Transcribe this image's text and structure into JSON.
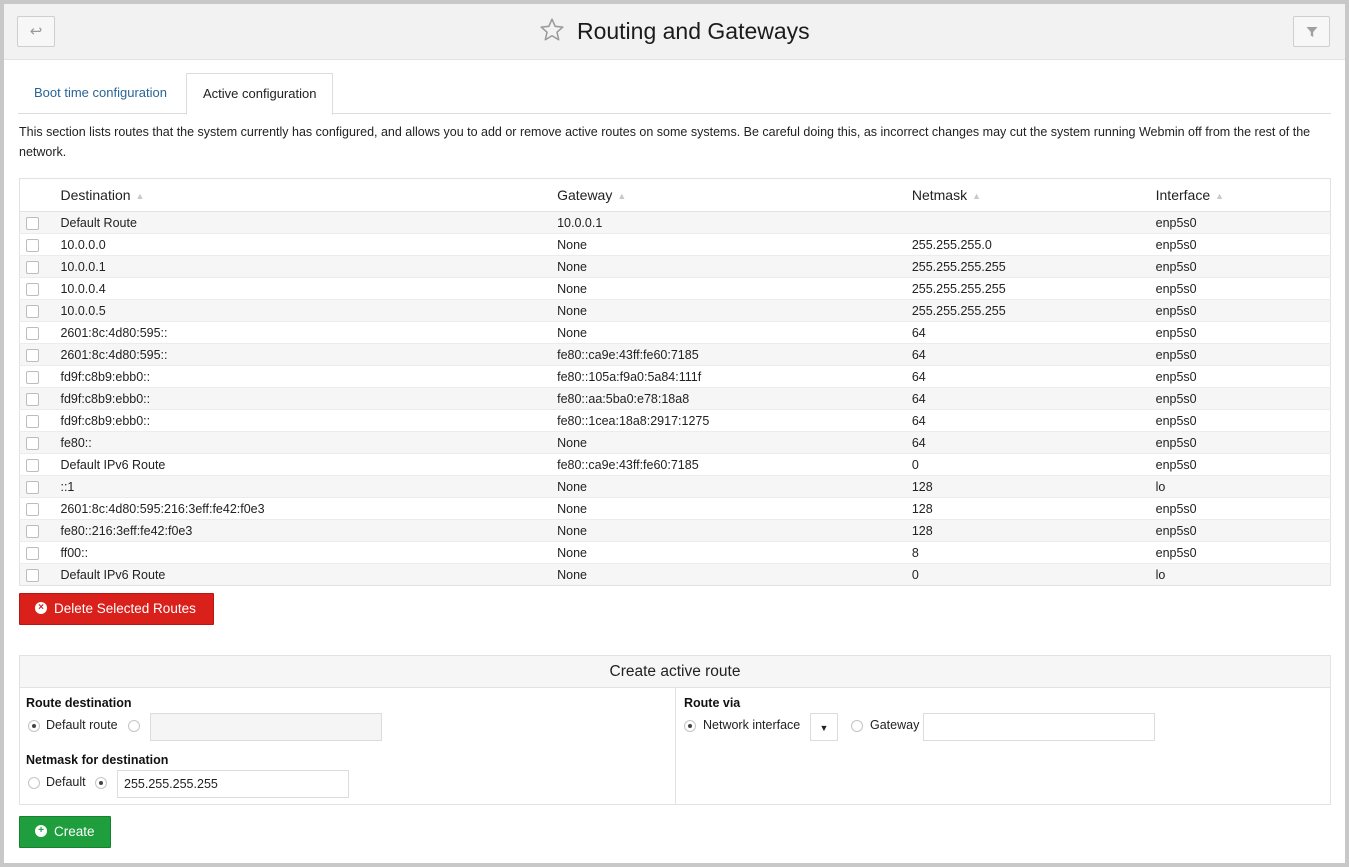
{
  "header": {
    "title": "Routing and Gateways",
    "back_icon": "↩",
    "filter_icon": "filter-icon"
  },
  "tabs": [
    {
      "label": "Boot time configuration",
      "active": false
    },
    {
      "label": "Active configuration",
      "active": true
    }
  ],
  "description": "This section lists routes that the system currently has configured, and allows you to add or remove active routes on some systems. Be careful doing this, as incorrect changes may cut the system running Webmin off from the rest of the network.",
  "table": {
    "columns": [
      "Destination",
      "Gateway",
      "Netmask",
      "Interface"
    ],
    "rows": [
      [
        "Default Route",
        "10.0.0.1",
        "",
        "enp5s0"
      ],
      [
        "10.0.0.0",
        "None",
        "255.255.255.0",
        "enp5s0"
      ],
      [
        "10.0.0.1",
        "None",
        "255.255.255.255",
        "enp5s0"
      ],
      [
        "10.0.0.4",
        "None",
        "255.255.255.255",
        "enp5s0"
      ],
      [
        "10.0.0.5",
        "None",
        "255.255.255.255",
        "enp5s0"
      ],
      [
        "2601:8c:4d80:595::",
        "None",
        "64",
        "enp5s0"
      ],
      [
        "2601:8c:4d80:595::",
        "fe80::ca9e:43ff:fe60:7185",
        "64",
        "enp5s0"
      ],
      [
        "fd9f:c8b9:ebb0::",
        "fe80::105a:f9a0:5a84:111f",
        "64",
        "enp5s0"
      ],
      [
        "fd9f:c8b9:ebb0::",
        "fe80::aa:5ba0:e78:18a8",
        "64",
        "enp5s0"
      ],
      [
        "fd9f:c8b9:ebb0::",
        "fe80::1cea:18a8:2917:1275",
        "64",
        "enp5s0"
      ],
      [
        "fe80::",
        "None",
        "64",
        "enp5s0"
      ],
      [
        "Default IPv6 Route",
        "fe80::ca9e:43ff:fe60:7185",
        "0",
        "enp5s0"
      ],
      [
        "::1",
        "None",
        "128",
        "lo"
      ],
      [
        "2601:8c:4d80:595:216:3eff:fe42:f0e3",
        "None",
        "128",
        "enp5s0"
      ],
      [
        "fe80::216:3eff:fe42:f0e3",
        "None",
        "128",
        "enp5s0"
      ],
      [
        "ff00::",
        "None",
        "8",
        "enp5s0"
      ],
      [
        "Default IPv6 Route",
        "None",
        "0",
        "lo"
      ]
    ]
  },
  "delete_button": "Delete Selected Routes",
  "form": {
    "title": "Create active route",
    "route_destination_label": "Route destination",
    "default_route_label": "Default route",
    "destination_value": "",
    "netmask_label": "Netmask for destination",
    "netmask_default_label": "Default",
    "netmask_value": "255.255.255.255",
    "route_via_label": "Route via",
    "network_interface_label": "Network interface",
    "gateway_label": "Gateway",
    "gateway_value": ""
  },
  "create_button": "Create",
  "colors": {
    "delete": "#d9201b",
    "create": "#1e9e3c",
    "link": "#2a6496"
  }
}
